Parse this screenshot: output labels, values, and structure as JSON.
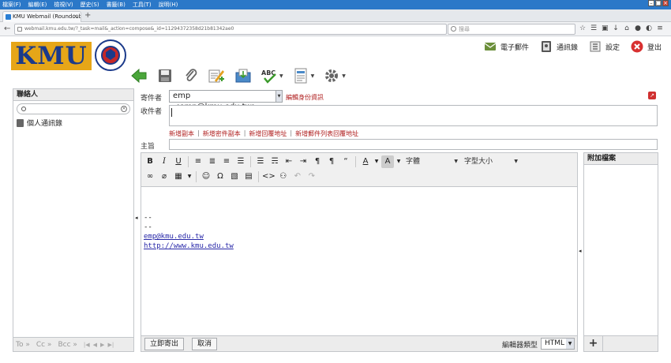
{
  "browser": {
    "menu": [
      "檔案(F)",
      "編輯(E)",
      "檢視(V)",
      "歷史(S)",
      "書籤(B)",
      "工具(T)",
      "說明(H)"
    ],
    "tab_title": "KMU Webmail (Roundcube)",
    "tab_close": "×",
    "new_tab": "+",
    "url": "webmail.kmu.edu.tw/?_task=mail&_action=compose&_id=11294372358d21b81342ae0",
    "search_placeholder": "搜尋",
    "window_minimize": "–",
    "window_restore": "□",
    "window_close": "×"
  },
  "brand": {
    "logo_text": "KMU",
    "colors": {
      "logo_bg": "#e6a618",
      "logo_text": "#1b3a8a",
      "link_red": "#b02020"
    }
  },
  "topnav": [
    {
      "label": "電子郵件",
      "icon": "email-icon"
    },
    {
      "label": "通訊錄",
      "icon": "addressbook-icon"
    },
    {
      "label": "設定",
      "icon": "settings-icon"
    },
    {
      "label": "登出",
      "icon": "logout-icon"
    }
  ],
  "toolbar": [
    "back-icon",
    "save-icon",
    "attach-icon",
    "signature-icon",
    "insert-response-icon",
    "spellcheck-icon",
    "encoding-icon",
    "options-icon"
  ],
  "contacts": {
    "title": "聯絡人",
    "item": "個人通訊錄",
    "to": "To »",
    "cc": "Cc »",
    "bcc": "Bcc »"
  },
  "compose": {
    "from_label": "寄件者",
    "from_value": "emp <emp@kmu.edu.tw>",
    "edit_identity": "編輯身份資訊",
    "to_label": "收件者",
    "add_cc": "新增副本",
    "add_bcc": "新增密件副本",
    "add_reply_to": "新增回覆地址",
    "add_followup_to": "新增郵件列表回覆地址",
    "subject_label": "主旨"
  },
  "editor": {
    "font_family": "字體",
    "font_size": "字型大小",
    "signature_dash1": "--",
    "signature_dash2": "--",
    "email_link": "emp@kmu.edu.tw",
    "web_link": "http://www.kmu.edu.tw",
    "send": "立即寄出",
    "cancel": "取消",
    "editor_type_label": "編輯器類型",
    "editor_type_value": "HTML"
  },
  "attachments": {
    "title": "附加檔案",
    "add": "+"
  }
}
